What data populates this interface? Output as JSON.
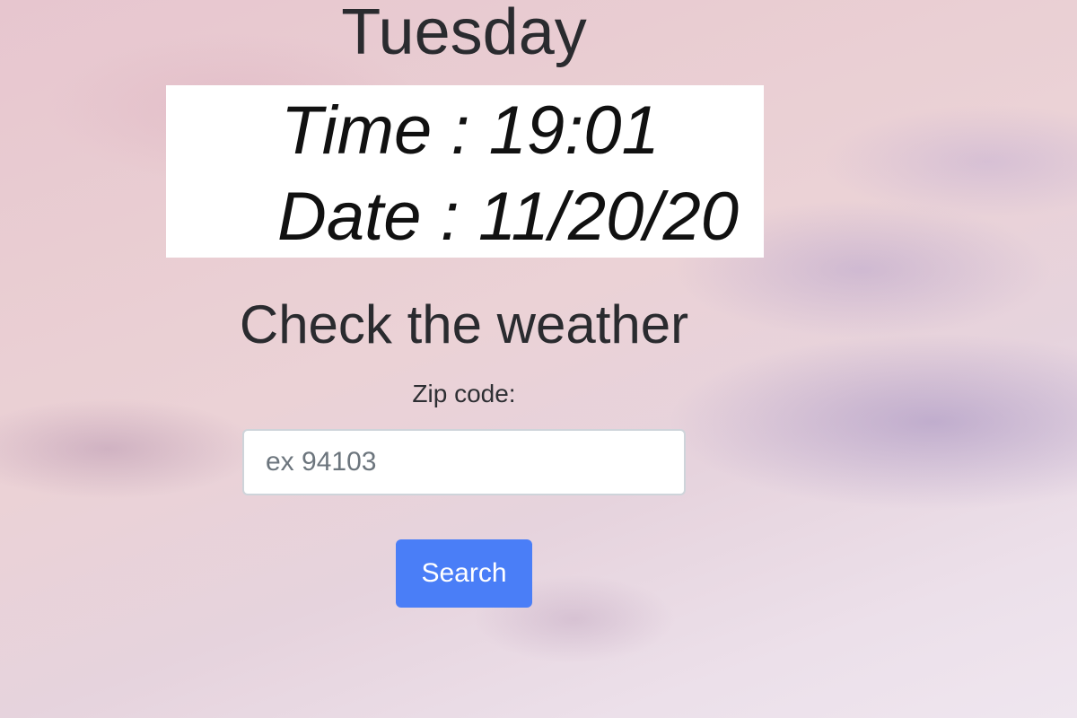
{
  "day": "Tuesday",
  "clock": {
    "time_label": "Time : 19:01",
    "date_label": "Date : 11/20/20"
  },
  "weather": {
    "heading": "Check the weather",
    "zip_label": "Zip code:",
    "zip_placeholder": "ex 94103",
    "zip_value": "",
    "search_label": "Search"
  },
  "colors": {
    "button": "#4a7ef7",
    "card": "#ffffff",
    "text": "#2a2b2f"
  }
}
